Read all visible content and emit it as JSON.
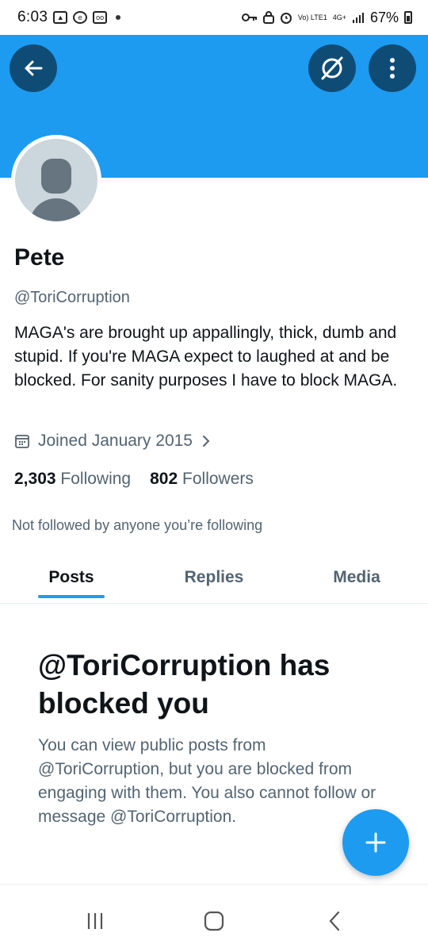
{
  "status_bar": {
    "time": "6:03",
    "network": "Vo) LTE1",
    "network_type": "4G+",
    "battery": "67%",
    "icons": [
      "gallery-icon",
      "data-saver-icon",
      "voicemail-icon",
      "dot-icon",
      "vpn-key-icon",
      "lock-icon",
      "alarm-icon",
      "signal-icon",
      "battery-icon"
    ]
  },
  "header": {
    "banner_color": "#1d9bf0",
    "back_icon": "arrow-left-icon",
    "grok_icon": "slashed-circle-icon",
    "more_icon": "more-vertical-icon"
  },
  "profile": {
    "display_name": "Pete",
    "handle": "@ToriCorruption",
    "bio": "MAGA's are brought up appallingly, thick, dumb and stupid. If you're MAGA expect to laughed at and be blocked. For sanity purposes I have to block MAGA.",
    "joined": "Joined January 2015",
    "following_count": "2,303",
    "following_label": "Following",
    "followers_count": "802",
    "followers_label": "Followers",
    "not_followed_text": "Not followed by anyone you’re following"
  },
  "tabs": [
    {
      "label": "Posts",
      "active": true
    },
    {
      "label": "Replies",
      "active": false
    },
    {
      "label": "Media",
      "active": false
    }
  ],
  "blocked": {
    "title": "@ToriCorruption has blocked you",
    "description": "You can view public posts from @ToriCorruption, but you are blocked from engaging with them. You also cannot follow or message @ToriCorruption."
  },
  "fab": {
    "icon": "plus-icon",
    "color": "#1d9bf0"
  },
  "nav_bar": {
    "icons": [
      "recent-apps-icon",
      "home-icon",
      "back-icon"
    ]
  }
}
